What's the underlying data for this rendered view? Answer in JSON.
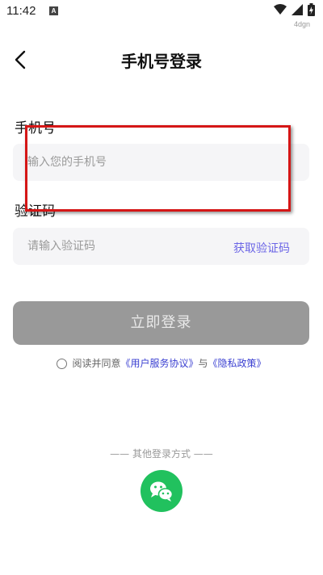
{
  "status": {
    "time": "11:42",
    "watermark": "4dgn"
  },
  "header": {
    "title": "手机号登录"
  },
  "phone": {
    "label": "手机号",
    "placeholder": "输入您的手机号"
  },
  "code": {
    "label": "验证码",
    "placeholder": "请输入验证码",
    "get_code": "获取验证码"
  },
  "login_button": "立即登录",
  "agreement": {
    "prefix": "阅读并同意",
    "user_agreement": "《用户服务协议》",
    "conjunction": "与",
    "privacy_policy": "《隐私政策》"
  },
  "other_login": {
    "label": "—— 其他登录方式 ——",
    "wechat_icon": "wechat-icon"
  },
  "colors": {
    "accent": "#6b65e6",
    "button": "#999999",
    "wechat": "#21c15e",
    "highlight": "#d51616"
  }
}
